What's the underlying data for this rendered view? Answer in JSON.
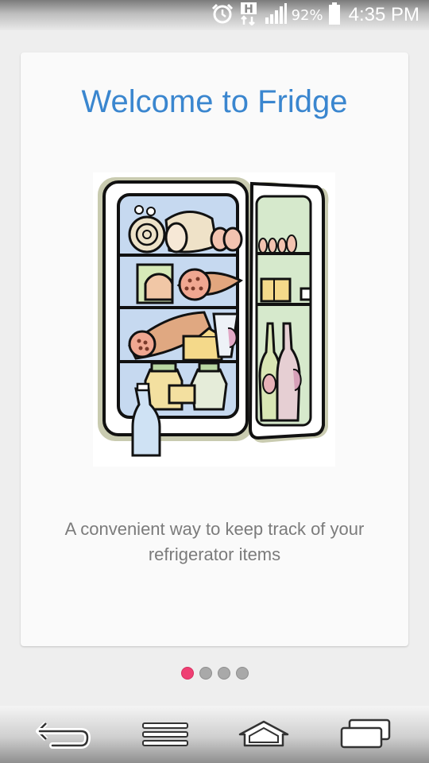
{
  "status_bar": {
    "network_badge": "H",
    "battery_percent": "92%",
    "time": "4:35 PM"
  },
  "onboarding": {
    "title": "Welcome to Fridge",
    "description_line1": "A convenient way to keep track of your",
    "description_line2": "refrigerator items",
    "illustration": "open-fridge-illustration"
  },
  "pager": {
    "total_pages": 4,
    "current_page": 1
  },
  "nav_bar": {
    "buttons": [
      "back-icon",
      "menu-icon",
      "home-icon",
      "recent-apps-icon"
    ]
  },
  "colors": {
    "title": "#3a86cf",
    "active_dot": "#ef3f73",
    "inactive_dot": "#a9a9a9",
    "description": "#7b7b7b"
  }
}
